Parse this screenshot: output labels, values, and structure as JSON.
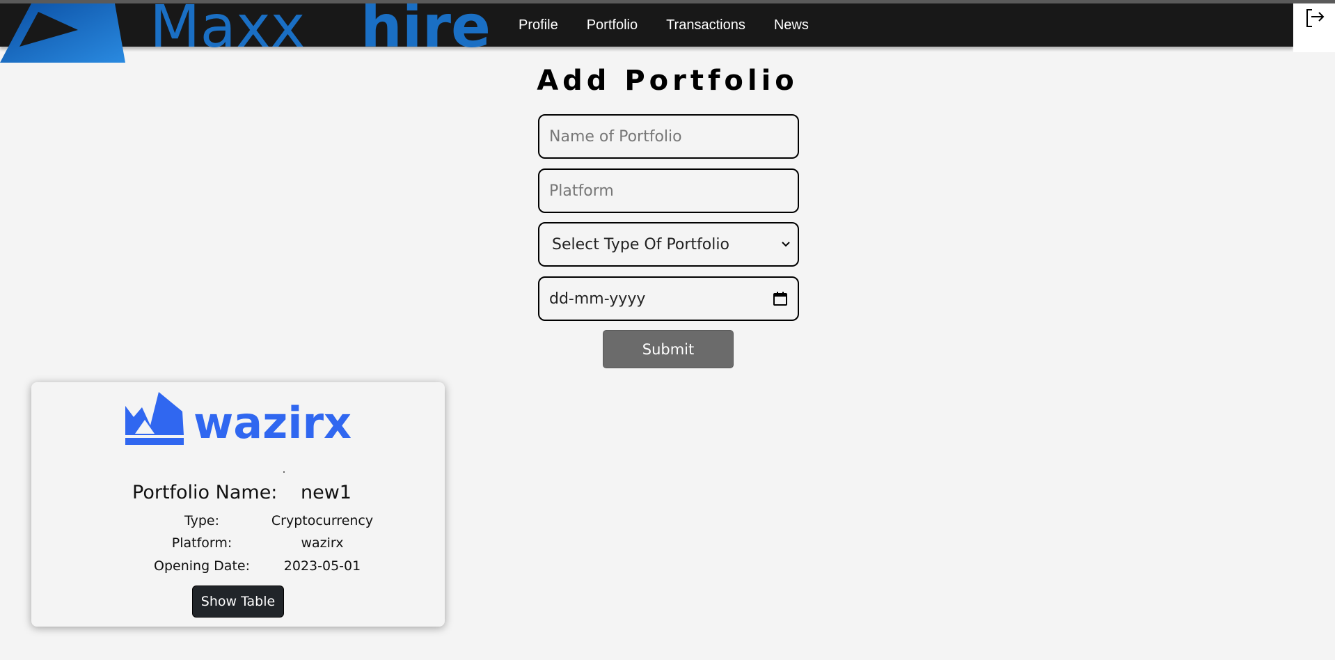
{
  "brand": {
    "name_light": "Maxx",
    "name_bold": "hire",
    "color": "#1a6fc4"
  },
  "nav": {
    "items": [
      "Profile",
      "Portfolio",
      "Transactions",
      "News"
    ]
  },
  "logout": {
    "icon": "logout-icon"
  },
  "form": {
    "title": "Add Portfolio",
    "name_placeholder": "Name of Portfolio",
    "platform_placeholder": "Platform",
    "type_select_value": "Select Type Of Portfolio",
    "date_placeholder": "dd-mm-yyyy",
    "submit_label": "Submit"
  },
  "portfolio_cards": [
    {
      "logo_text": "wazirx",
      "logo_color": "#3067f0",
      "name_label": "Portfolio Name:",
      "name_value": "new1",
      "type_label": "Type:",
      "type_value": "Cryptocurrency",
      "platform_label": "Platform:",
      "platform_value": "wazirx",
      "date_label": "Opening Date:",
      "date_value": "2023-05-01",
      "button_label": "Show Table"
    }
  ]
}
